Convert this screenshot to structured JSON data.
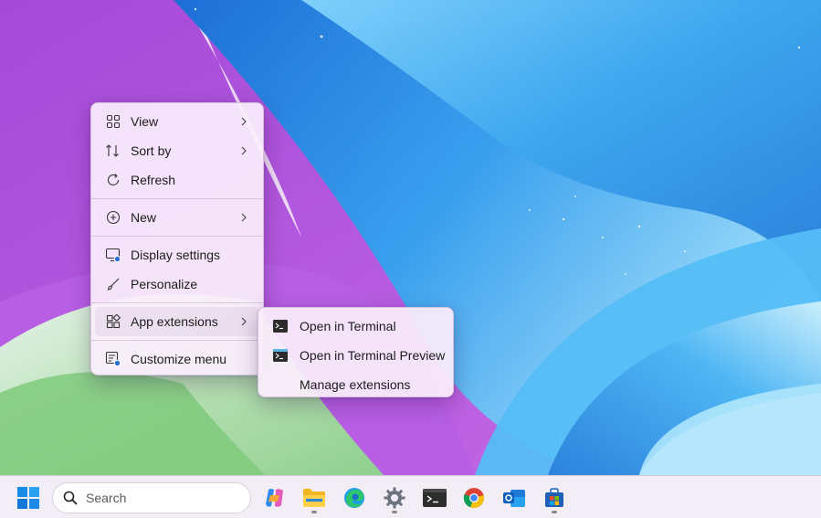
{
  "context_menu": {
    "items": [
      {
        "label": "View",
        "icon": "view-grid-icon",
        "has_submenu": true
      },
      {
        "label": "Sort by",
        "icon": "sort-icon",
        "has_submenu": true
      },
      {
        "label": "Refresh",
        "icon": "refresh-icon",
        "has_submenu": false
      },
      {
        "label": "New",
        "icon": "new-plus-icon",
        "has_submenu": true
      },
      {
        "label": "Display settings",
        "icon": "display-settings-icon",
        "has_submenu": false
      },
      {
        "label": "Personalize",
        "icon": "brush-icon",
        "has_submenu": false
      },
      {
        "label": "App extensions",
        "icon": "app-extensions-icon",
        "has_submenu": true
      },
      {
        "label": "Customize menu",
        "icon": "customize-menu-icon",
        "has_submenu": false
      }
    ]
  },
  "submenu": {
    "items": [
      {
        "label": "Open in Terminal",
        "icon": "terminal-icon"
      },
      {
        "label": "Open in Terminal Preview",
        "icon": "terminal-preview-icon"
      },
      {
        "label": "Manage extensions",
        "icon": ""
      }
    ]
  },
  "taskbar": {
    "search_placeholder": "Search",
    "apps": [
      "start-icon",
      "copilot-icon",
      "file-explorer-icon",
      "edge-icon",
      "settings-icon",
      "terminal-icon",
      "chrome-icon",
      "outlook-icon",
      "store-icon"
    ]
  },
  "colors": {
    "wallpaper_purple": "#b24fe4",
    "wallpaper_blue": "#3fa6ee",
    "menu_bg": "#faeefc",
    "taskbar_bg": "#f3ecf6"
  }
}
